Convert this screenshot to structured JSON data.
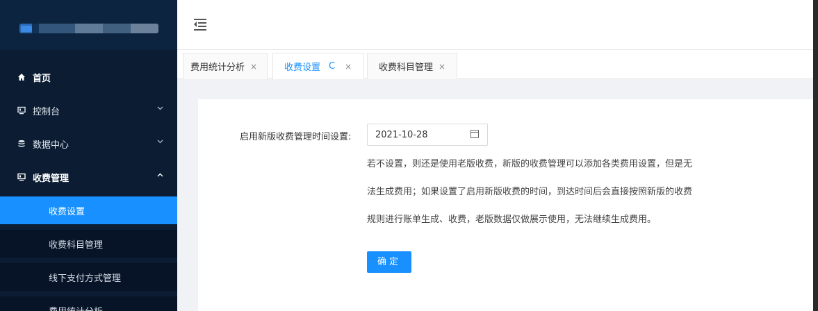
{
  "sidebar": {
    "nav": [
      {
        "label": "首页",
        "icon": "home-icon"
      },
      {
        "label": "控制台",
        "icon": "monitor-icon",
        "arrow": "chevron-down-icon"
      },
      {
        "label": "数据中心",
        "icon": "database-icon",
        "arrow": "chevron-down-icon"
      },
      {
        "label": "收费管理",
        "icon": "monitor-icon",
        "arrow": "chevron-up-icon"
      }
    ],
    "sub_items": [
      {
        "label": "收费设置",
        "active": true
      },
      {
        "label": "收费科目管理"
      },
      {
        "label": "线下支付方式管理"
      },
      {
        "label": "费用统计分析"
      }
    ]
  },
  "tabs": [
    {
      "label": "费用统计分析",
      "close": "×"
    },
    {
      "label": "收费设置",
      "close": "×",
      "refresh": "C",
      "active": true
    },
    {
      "label": "收费科目管理",
      "close": "×"
    }
  ],
  "form": {
    "label": "启用新版收费管理时间设置:",
    "date_value": "2021-10-28",
    "help_lines": [
      "若不设置，则还是使用老版收费，新版的收费管理可以添加各类费用设置，但是无",
      "法生成费用；如果设置了启用新版收费的时间，到达时间后会直接按照新版的收费",
      "规则进行账单生成、收费，老版数据仅做展示使用，无法继续生成费用。"
    ],
    "confirm_label": "确定"
  },
  "colors": {
    "sidebar_bg": "#0b1c33",
    "accent": "#1890ff"
  }
}
